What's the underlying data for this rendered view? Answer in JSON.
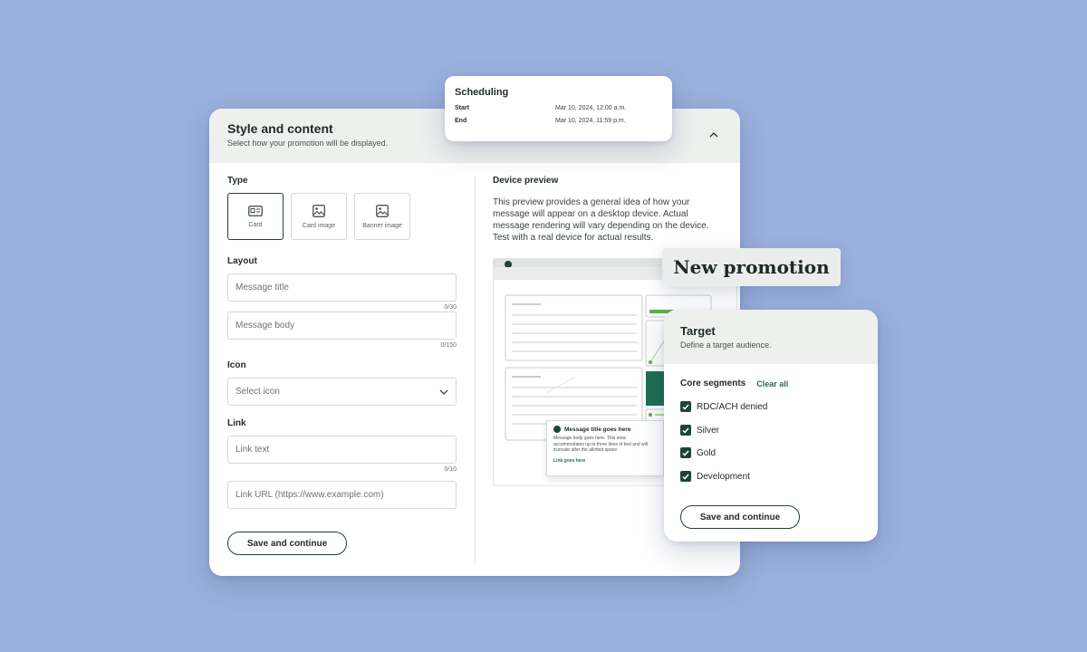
{
  "main_card": {
    "title": "Style and content",
    "subtitle": "Select how your promotion will be displayed.",
    "collapse_icon": "chevron-up-icon"
  },
  "type_section": {
    "label": "Type",
    "options": [
      {
        "label": "Card",
        "icon": "card-icon",
        "selected": true
      },
      {
        "label": "Card image",
        "icon": "image-icon",
        "selected": false
      },
      {
        "label": "Banner image",
        "icon": "image-icon",
        "selected": false
      }
    ]
  },
  "layout_section": {
    "label": "Layout",
    "title_placeholder": "Message title",
    "title_counter": "0/30",
    "body_placeholder": "Message body",
    "body_counter": "0/150"
  },
  "icon_section": {
    "label": "Icon",
    "select_placeholder": "Select icon"
  },
  "link_section": {
    "label": "Link",
    "text_placeholder": "Link text",
    "text_counter": "0/10",
    "url_placeholder": "Link URL (https://www.example.com)"
  },
  "main_save_label": "Save and continue",
  "preview": {
    "label": "Device preview",
    "description": "This preview provides a general idea of how your message will appear on a desktop device. Actual message rendering will vary depending on the device. Test with a real device for actual results.",
    "mock_message_title": "Message title goes here",
    "mock_message_body": "Message body goes here. This area accommodates up to three lines of text and will truncate after the allotted space.",
    "mock_link": "Link goes here"
  },
  "scheduling": {
    "title": "Scheduling",
    "start_label": "Start",
    "start_value": "Mar 10, 2024, 12:00 a.m.",
    "end_label": "End",
    "end_value": "Mar 10, 2024, 11:59 p.m."
  },
  "promo_pill": "New promotion",
  "target": {
    "title": "Target",
    "subtitle": "Define a target audience.",
    "segments_label": "Core segments",
    "clear_all": "Clear all",
    "segments": [
      "RDC/ACH denied",
      "Silver",
      "Gold",
      "Development"
    ],
    "save_label": "Save and continue"
  },
  "colors": {
    "background": "#9bb0dd",
    "brand_green": "#1e4437",
    "accent_green": "#5fae4b",
    "header_gray": "#eef0ee"
  }
}
